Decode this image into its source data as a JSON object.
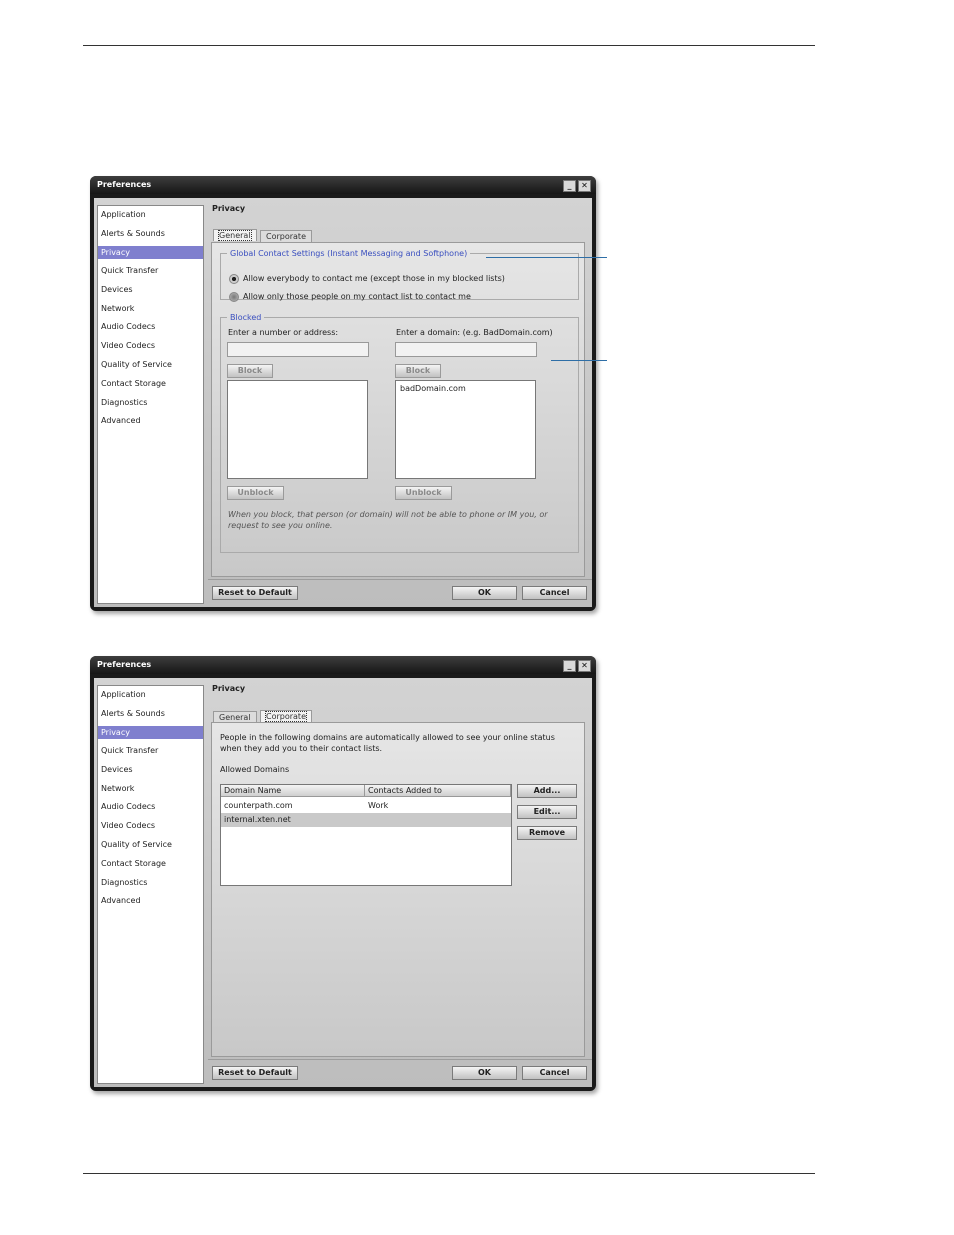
{
  "window_title": "Preferences",
  "nav_items": [
    "Application",
    "Alerts & Sounds",
    "Privacy",
    "Quick Transfer",
    "Devices",
    "Network",
    "Audio Codecs",
    "Video Codecs",
    "Quality of Service",
    "Contact Storage",
    "Diagnostics",
    "Advanced"
  ],
  "selected_nav": "Privacy",
  "pane_title": "Privacy",
  "tabs": [
    "General",
    "Corporate"
  ],
  "general": {
    "group_title": "Global Contact Settings (Instant Messaging and Softphone)",
    "radio_everybody": "Allow everybody to contact me (except those in my blocked lists)",
    "radio_contact_list": "Allow only those people on my contact list to contact me",
    "selected_radio": "everybody",
    "blocked_group": "Blocked",
    "number_label": "Enter a number or address:",
    "domain_label": "Enter a domain: (e.g. BadDomain.com)",
    "block_button": "Block",
    "unblock_button": "Unblock",
    "blocked_domains": [
      "badDomain.com"
    ],
    "hint": "When you block, that person (or domain) will not be able to phone or IM you, or request to see you online."
  },
  "corporate": {
    "description": "People in the following domains are automatically allowed to see your online status when they add you to their contact lists.",
    "allowed_label": "Allowed Domains",
    "columns": [
      "Domain Name",
      "Contacts Added to"
    ],
    "rows": [
      {
        "domain": "counterpath.com",
        "group": "Work"
      },
      {
        "domain": "internal.xten.net",
        "group": ""
      }
    ],
    "add_button": "Add...",
    "edit_button": "Edit...",
    "remove_button": "Remove"
  },
  "footer": {
    "reset_button": "Reset to Default",
    "ok_button": "OK",
    "cancel_button": "Cancel"
  }
}
